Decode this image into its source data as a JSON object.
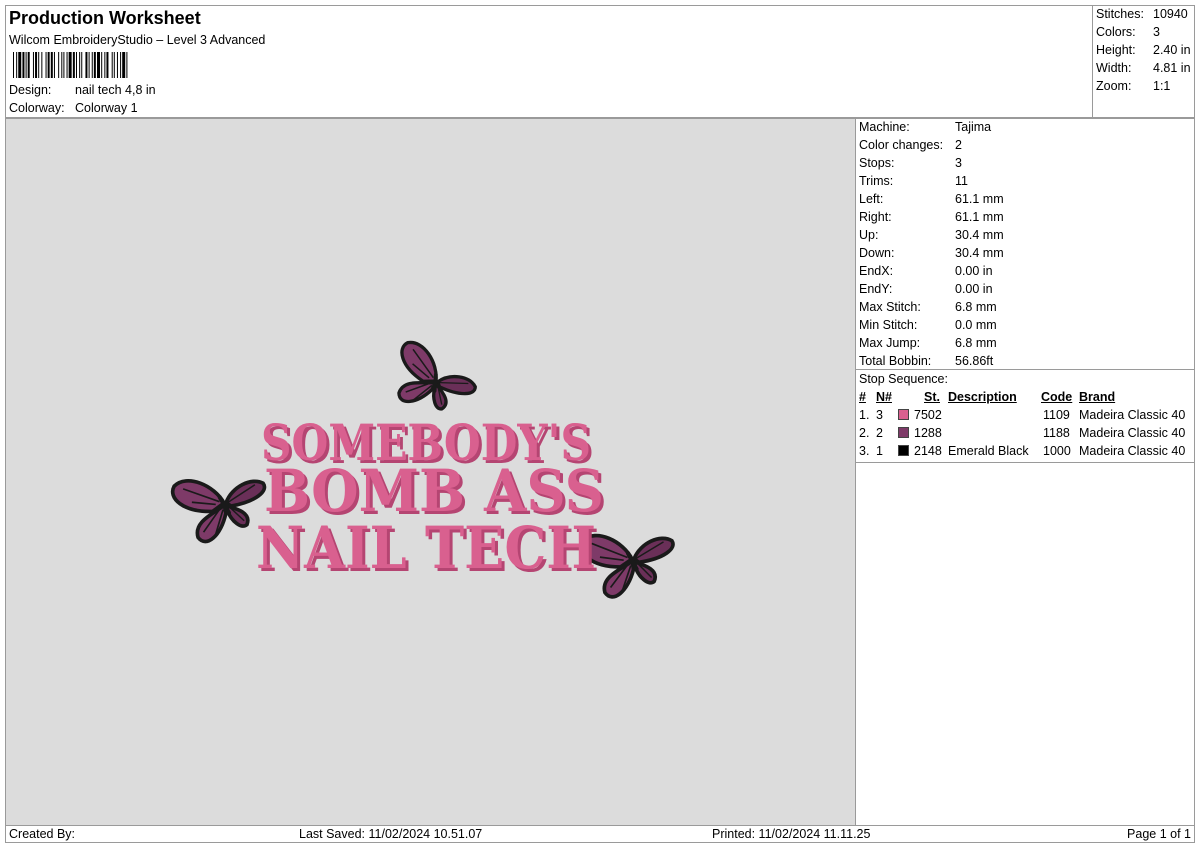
{
  "header": {
    "title": "Production Worksheet",
    "software": "Wilcom EmbroideryStudio – Level 3 Advanced",
    "design_label": "Design:",
    "design_value": "nail tech 4,8 in",
    "colorway_label": "Colorway:",
    "colorway_value": "Colorway 1"
  },
  "summary": [
    {
      "label": "Stitches:",
      "value": "10940"
    },
    {
      "label": "Colors:",
      "value": "3"
    },
    {
      "label": "Height:",
      "value": "2.40 in"
    },
    {
      "label": "Width:",
      "value": "4.81 in"
    },
    {
      "label": "Zoom:",
      "value": "1:1"
    }
  ],
  "machine": [
    {
      "label": "Machine:",
      "value": "Tajima"
    },
    {
      "label": "Color changes:",
      "value": "2"
    },
    {
      "label": "Stops:",
      "value": "3"
    },
    {
      "label": "Trims:",
      "value": "11"
    },
    {
      "label": "Left:",
      "value": "61.1 mm"
    },
    {
      "label": "Right:",
      "value": "61.1 mm"
    },
    {
      "label": "Up:",
      "value": "30.4 mm"
    },
    {
      "label": "Down:",
      "value": "30.4 mm"
    },
    {
      "label": "EndX:",
      "value": "0.00 in"
    },
    {
      "label": "EndY:",
      "value": "0.00 in"
    },
    {
      "label": "Max Stitch:",
      "value": "6.8 mm"
    },
    {
      "label": "Min Stitch:",
      "value": "0.0 mm"
    },
    {
      "label": "Max Jump:",
      "value": "6.8 mm"
    },
    {
      "label": "Total Bobbin:",
      "value": "56.86ft"
    }
  ],
  "stop_sequence": {
    "title": "Stop Sequence:",
    "headers": {
      "num": "#",
      "n": "N#",
      "st": "St.",
      "desc": "Description",
      "code": "Code",
      "brand": "Brand"
    },
    "rows": [
      {
        "num": "1.",
        "n": "3",
        "color": "#d9608f",
        "st": "7502",
        "desc": "",
        "code": "1109",
        "brand": "Madeira Classic 40"
      },
      {
        "num": "2.",
        "n": "2",
        "color": "#7e3a68",
        "st": "1288",
        "desc": "",
        "code": "1188",
        "brand": "Madeira Classic 40"
      },
      {
        "num": "3.",
        "n": "1",
        "color": "#000000",
        "st": "2148",
        "desc": "Emerald Black",
        "code": "1000",
        "brand": "Madeira Classic 40"
      }
    ]
  },
  "design_text": {
    "line1": "SOMEBODY'S",
    "line2": "BOMB ASS",
    "line3": "NAIL TECH"
  },
  "colors": {
    "text_pink": "#d9608f",
    "text_shadow": "#b54572",
    "wing_purple": "#7e3a68",
    "outline": "#1a1a1a",
    "background": "#dcdcdc"
  },
  "footer": {
    "created_by": "Created By:",
    "last_saved": "Last Saved: 11/02/2024 10.51.07",
    "printed": "Printed: 11/02/2024 11.11.25",
    "page": "Page 1 of 1"
  }
}
